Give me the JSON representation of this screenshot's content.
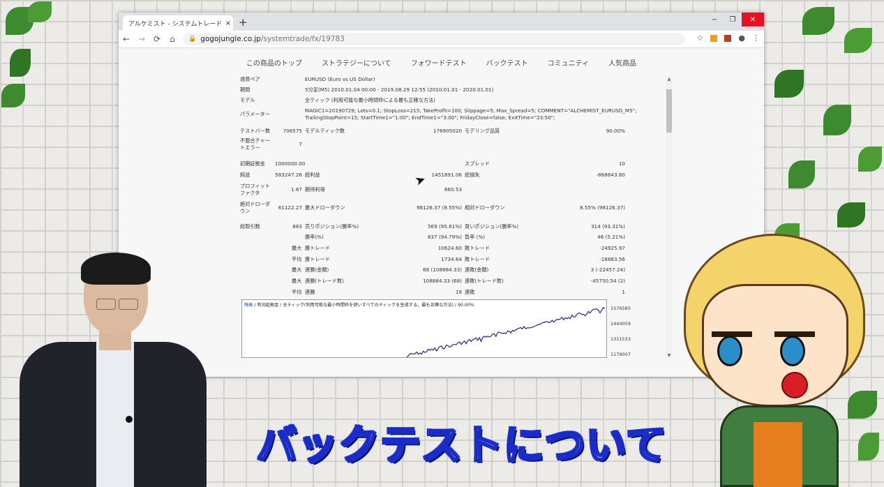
{
  "browser": {
    "tab_title": "アルケミスト - システムトレード - 自動",
    "tab_close": "×",
    "new_tab": "+",
    "window": {
      "minimize": "−",
      "maximize": "❐",
      "close": "✕"
    },
    "nav": {
      "back": "←",
      "forward": "→",
      "reload": "⟳",
      "home": "⌂"
    },
    "url_host": "gogojungle.co.jp",
    "url_path": "/systemtrade/fx/19783"
  },
  "site_nav": [
    "この商品のトップ",
    "ストラテジーについて",
    "フォワードテスト",
    "バックテスト",
    "コミュニティ",
    "人気商品"
  ],
  "report": {
    "currency_label": "通貨ペア",
    "currency_value": "EURUSD (Euro vs US Dollar)",
    "period_label": "期間",
    "period_value": "5分足(M5) 2010.01.04 00:00 - 2019.08.29 12:55 (2010.01.01 - 2020.01.01)",
    "model_label": "モデル",
    "model_value": "全ティック (利用可能な最小時間枠による最も正確な方法)",
    "param_label": "パラメーター",
    "param_line1": "MAGIC1=20190729; Lots=0.1; StopLoss=215; TakeProfit=100; Slippage=5; Max_Spread=5; COMMENT=\"ALCHEMIST_EURUSD_M5\";",
    "param_line2": "TrailingStopPoint=15; StartTime1=\"1:00\"; EndTime1=\"3:00\"; FridayClose=false; ExitTime=\"23:50\";",
    "bars_label": "テストバー数",
    "bars_value": "706575",
    "ticks_label": "モデルティック数",
    "ticks_value": "176905020",
    "quality_label": "モデリング品質",
    "quality_value": "90.00%",
    "mismatch_label1": "不整合チャー",
    "mismatch_label2": "トエラー",
    "mismatch_value": "7",
    "deposit_label": "初期証拠金",
    "deposit_value": "1000000.00",
    "spread_label": "スプレッド",
    "spread_value": "10",
    "net_label": "純益",
    "net_value": "583247.26",
    "gross_profit_label": "総利益",
    "gross_profit_value": "1451891.06",
    "gross_loss_label": "総損失",
    "gross_loss_value": "-868643.80",
    "pf_label1": "プロフィット",
    "pf_label2": "ファクタ",
    "pf_value": "1.67",
    "expected_label": "期待利得",
    "expected_value": "660.53",
    "abs_dd_label1": "絶対ドローダ",
    "abs_dd_label2": "ウン",
    "abs_dd_value": "61122.27",
    "max_dd_label": "最大ドローダウン",
    "max_dd_value": "98126.37 (8.55%)",
    "rel_dd_label": "相対ドローダウン",
    "rel_dd_value": "8.55% (98126.37)",
    "trades_label": "総取引数",
    "trades_value": "883",
    "short_label": "売りポジション(勝率%)",
    "short_value": "569 (95.61%)",
    "long_label": "買いポジション(勝率%)",
    "long_value": "314 (93.31%)",
    "winrate_label": "勝率(%)",
    "winrate_value": "837 (94.79%)",
    "lossrate_label": "負率 (%)",
    "lossrate_value": "46 (5.21%)",
    "max_label": "最大",
    "avg_label": "平均",
    "win_trade_label": "勝トレード",
    "loss_trade_label": "敗トレード",
    "max_win_value": "10624.60",
    "max_loss_value": "-24925.97",
    "avg_win_value": "1734.64",
    "avg_loss_value": "-18883.56",
    "cons_win_amt_label": "連勝(金額)",
    "cons_win_amt_value": "68 (108884.33)",
    "cons_loss_amt_label": "連敗(金額)",
    "cons_loss_amt_value": "3 (-22457.24)",
    "cons_win_cnt_label": "連勝(トレード数)",
    "cons_win_cnt_value": "108884.33 (68)",
    "cons_loss_cnt_label": "連敗(トレード数)",
    "cons_loss_cnt_value": "-45750.54 (2)",
    "avg_cons_win_label": "連勝",
    "avg_cons_win_value": "19",
    "avg_cons_loss_label": "連敗",
    "avg_cons_loss_value": "1"
  },
  "chart_data": {
    "type": "line",
    "header_hl": "残高",
    "header_rest": "/ 有効証拠金 / 全ティック(利用可能な最小時間枠を使いすべてのティックを生成する。最も正確な方法) / 90.00%",
    "y_ticks": [
      "1576585",
      "1444059",
      "1311533",
      "1179007"
    ],
    "ylim": [
      1179007,
      1576585
    ],
    "color": "#1f2a7a"
  },
  "caption": "バックテストについて"
}
